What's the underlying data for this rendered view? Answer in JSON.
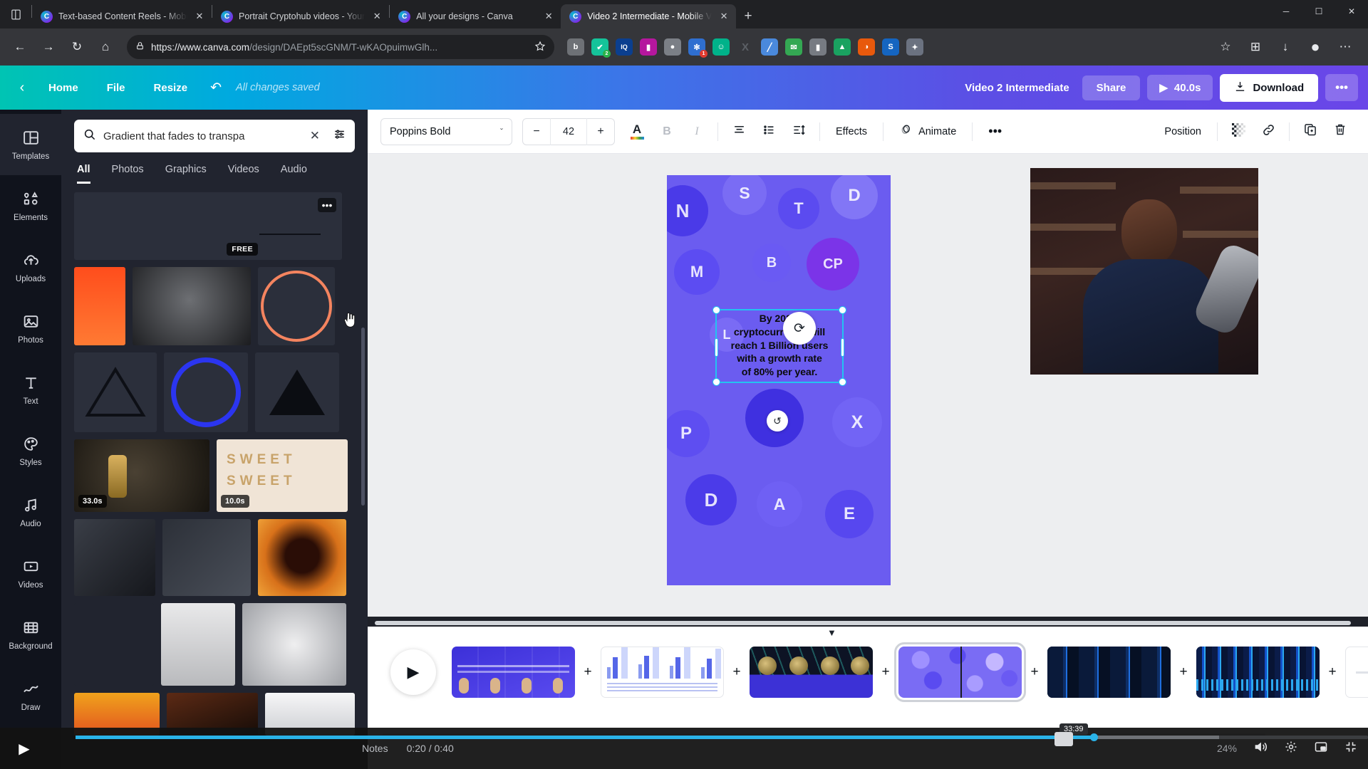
{
  "browser": {
    "tabs": [
      {
        "title": "Text-based Content Reels - Mobi",
        "close": "✕",
        "active": false
      },
      {
        "title": "Portrait Cryptohub videos - Your",
        "close": "✕",
        "active": false
      },
      {
        "title": "All your designs - Canva",
        "close": "✕",
        "active": false
      },
      {
        "title": "Video 2 Intermediate - Mobile V",
        "close": "✕",
        "active": true
      }
    ],
    "new_tab_label": "+",
    "window_controls": {
      "minimize": "─",
      "maximize": "☐",
      "close": "✕"
    },
    "nav": {
      "back": "←",
      "forward": "→",
      "reload": "↻",
      "home": "⌂"
    },
    "address": {
      "lock_icon": "lock-icon",
      "url_domain": "https://www.canva.com",
      "url_path": "/design/DAEpt5scGNM/T-wKAOpuimwGlh...",
      "bookmark_icon": "star-icon"
    },
    "extensions": [
      {
        "name": "extension-1",
        "glyph": "b",
        "color": "#6e7176",
        "badge": "",
        "badge_color": ""
      },
      {
        "name": "extension-grammarly",
        "glyph": "✔",
        "color": "#15c39a",
        "badge": "2",
        "badge_color": "#2ab34a"
      },
      {
        "name": "extension-iq",
        "glyph": "IQ",
        "color": "#0b3f8f",
        "badge": "",
        "badge_color": ""
      },
      {
        "name": "extension-analytics",
        "glyph": "▐",
        "color": "#b5179e",
        "badge": "",
        "badge_color": ""
      },
      {
        "name": "extension-camera",
        "glyph": "●",
        "color": "#7b7f86",
        "badge": "",
        "badge_color": ""
      },
      {
        "name": "extension-gear",
        "glyph": "✻",
        "color": "#2f6fd0",
        "badge": "1",
        "badge_color": "#e03a2f"
      },
      {
        "name": "extension-smiley",
        "glyph": "☺",
        "color": "#00b28a",
        "badge": "",
        "badge_color": ""
      },
      {
        "name": "extension-x",
        "glyph": "X",
        "color": "#5c6066",
        "badge": "",
        "badge_color": ""
      },
      {
        "name": "extension-pen",
        "glyph": "╱",
        "color": "#4a89dc",
        "badge": "",
        "badge_color": ""
      },
      {
        "name": "extension-mail",
        "glyph": "✉",
        "color": "#34a853",
        "badge": "",
        "badge_color": ""
      },
      {
        "name": "extension-bag",
        "glyph": "▮",
        "color": "#777b82",
        "badge": "",
        "badge_color": ""
      },
      {
        "name": "extension-drive",
        "glyph": "▲",
        "color": "#1aa260",
        "badge": "",
        "badge_color": ""
      },
      {
        "name": "extension-fox",
        "glyph": "◑",
        "color": "#e8590c",
        "badge": "",
        "badge_color": ""
      },
      {
        "name": "extension-s",
        "glyph": "S",
        "color": "#1565c0",
        "badge": "",
        "badge_color": ""
      },
      {
        "name": "extension-shield",
        "glyph": "✦",
        "color": "#6b7280",
        "badge": "",
        "badge_color": ""
      }
    ],
    "right_icons": [
      {
        "name": "favorites-icon",
        "glyph": "☆"
      },
      {
        "name": "collections-icon",
        "glyph": "⊞"
      },
      {
        "name": "downloads-icon",
        "glyph": "↓"
      },
      {
        "name": "profile-icon",
        "glyph": "●"
      },
      {
        "name": "settings-more-icon",
        "glyph": "⋯"
      }
    ]
  },
  "canva_header": {
    "back_icon": "chevron-left-icon",
    "home_label": "Home",
    "file_label": "File",
    "resize_label": "Resize",
    "undo_icon": "↶",
    "saved_status": "All changes saved",
    "doc_title": "Video 2 Intermediate",
    "share_label": "Share",
    "play_icon": "▶",
    "duration": "40.0s",
    "download_icon": "⤓",
    "download_label": "Download",
    "more_label": "•••"
  },
  "rail": {
    "items": [
      {
        "label": "Templates",
        "icon": "templates-icon",
        "active": true
      },
      {
        "label": "Elements",
        "icon": "elements-icon",
        "active": false
      },
      {
        "label": "Uploads",
        "icon": "uploads-icon",
        "active": false
      },
      {
        "label": "Photos",
        "icon": "photos-icon",
        "active": false
      },
      {
        "label": "Text",
        "icon": "text-icon",
        "active": false
      },
      {
        "label": "Styles",
        "icon": "styles-icon",
        "active": false
      },
      {
        "label": "Audio",
        "icon": "audio-icon",
        "active": false
      },
      {
        "label": "Videos",
        "icon": "videos-icon",
        "active": false
      },
      {
        "label": "Background",
        "icon": "background-icon",
        "active": false
      },
      {
        "label": "Draw",
        "icon": "draw-icon",
        "active": false
      }
    ]
  },
  "panel": {
    "search": {
      "value": "Gradient that fades to transpa",
      "placeholder": "Search",
      "search_icon": "search-icon",
      "clear_icon": "✕",
      "filter_icon": "filter-icon"
    },
    "tabs": [
      {
        "label": "All",
        "active": true
      },
      {
        "label": "Photos",
        "active": false
      },
      {
        "label": "Graphics",
        "active": false
      },
      {
        "label": "Videos",
        "active": false
      },
      {
        "label": "Audio",
        "active": false
      }
    ],
    "results": {
      "free_badge": "FREE",
      "more_icon": "•••",
      "durations": [
        "33.0s",
        "10.0s"
      ]
    },
    "collapse_icon": "‹"
  },
  "editor_toolbar": {
    "font_family": "Poppins Bold",
    "font_chevron": "ˇ",
    "size_decrease": "−",
    "font_size": "42",
    "size_increase": "+",
    "text_color_icon": "A",
    "bold_label": "B",
    "italic_label": "I",
    "align_icon": "align-center-icon",
    "list_icon": "bullet-list-icon",
    "spacing_icon": "line-spacing-icon",
    "effects_label": "Effects",
    "animate_label": "Animate",
    "more_label": "•••",
    "position_label": "Position",
    "transparency_icon": "transparency-icon",
    "link_icon": "link-icon",
    "duplicate_icon": "duplicate-icon",
    "delete_icon": "trash-icon"
  },
  "canvas": {
    "text_element": {
      "lines": [
        "By 2024,",
        "cryptocurrency will",
        "reach 1 Billion users",
        "with a growth rate",
        "of 80% per year."
      ],
      "full_text": "By 2024, cryptocurrency will reach 1 Billion users with a growth rate of 80% per year."
    },
    "page_background_color": "#6b5cf0",
    "rotate_icon": "⟳",
    "rotate_icon_small": "↺",
    "coins": [
      "N",
      "S",
      "T",
      "D",
      "CP",
      "M",
      "B",
      "P",
      "A",
      "X",
      "E",
      "L"
    ]
  },
  "timeline": {
    "play_icon": "▶",
    "add_icon": "+",
    "caret_icon": "▼",
    "clips": [
      {
        "name": "clip-1",
        "selected": false
      },
      {
        "name": "clip-2",
        "selected": false
      },
      {
        "name": "clip-3",
        "selected": false
      },
      {
        "name": "clip-4",
        "selected": true
      },
      {
        "name": "clip-5",
        "selected": false
      },
      {
        "name": "clip-6",
        "selected": false
      },
      {
        "name": "clip-7",
        "selected": false
      }
    ]
  },
  "video_player": {
    "play_icon": "▶",
    "notes_label": "Notes",
    "time": "0:20 / 0:40",
    "percent": "24%",
    "tooltip_time": "33:39",
    "volume_icon": "🔊",
    "settings_icon": "⚙",
    "miniplayer_icon": "❐",
    "fullscreen_icon": "⤡"
  }
}
